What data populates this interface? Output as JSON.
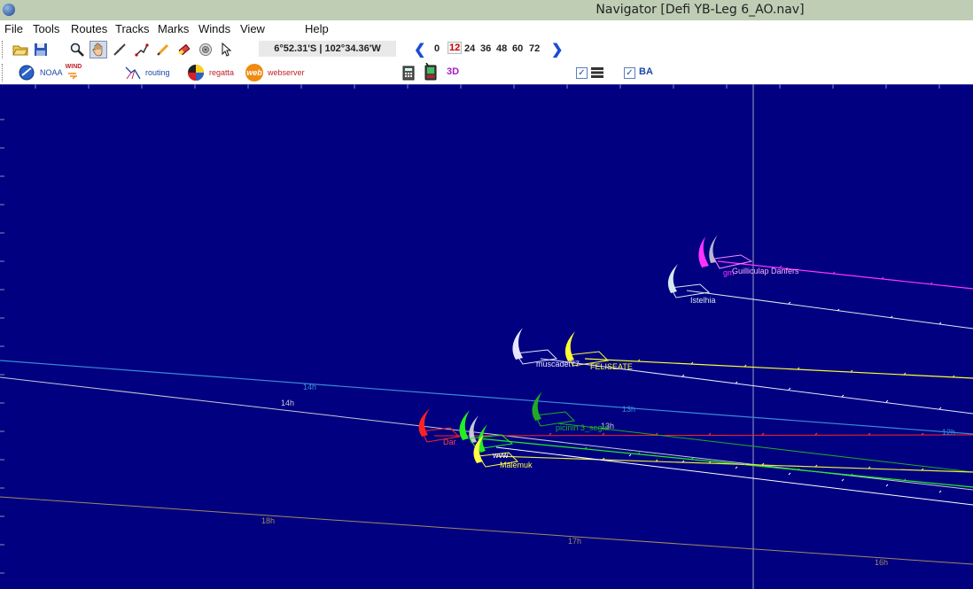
{
  "window": {
    "title": "Navigator [Defi YB-Leg 6_AO.nav]"
  },
  "menu": [
    "File",
    "Tools",
    "Routes",
    "Tracks",
    "Marks",
    "Winds",
    "View",
    "Help"
  ],
  "toolbar": {
    "coordinates": "6°52.31'S | 102°34.36'W",
    "hours": [
      "0",
      "12",
      "24",
      "36",
      "48",
      "60",
      "72"
    ],
    "selected_hour": "12"
  },
  "toolbar2": {
    "noaa_label": "NOAA",
    "wind_label": "WIND",
    "routing_label": "routing",
    "regatta_label": "regatta",
    "webserver_label": "webserver",
    "web_icon_text": "web",
    "view3d_label": "3D",
    "ba_label": "BA",
    "layers_checked": true,
    "ba_checked": true
  },
  "map": {
    "hour_labels": [
      "14h",
      "14h",
      "13h",
      "13h",
      "12h",
      "18h",
      "17h",
      "16h"
    ],
    "boats": [
      {
        "name": "Guilliculap Danfers",
        "color": "#ff33ff"
      },
      {
        "name": "Istelhia",
        "color": "#d8e8f0"
      },
      {
        "name": "muscadet77",
        "color": "#e6e6ff"
      },
      {
        "name": "FELISEATE",
        "color": "#ffff33"
      },
      {
        "name": "picinin 3_segfa",
        "color": "#22aa22"
      },
      {
        "name": "Dar",
        "color": "#ff2222"
      },
      {
        "name": "Malemuk",
        "color": "#ffff44"
      },
      {
        "name": "gm",
        "color": "#ff33ff"
      },
      {
        "name": "wvw",
        "color": "#ffffff"
      }
    ]
  },
  "colors": {
    "map_bg": "#000080",
    "titlebar": "#bfcdb4"
  }
}
